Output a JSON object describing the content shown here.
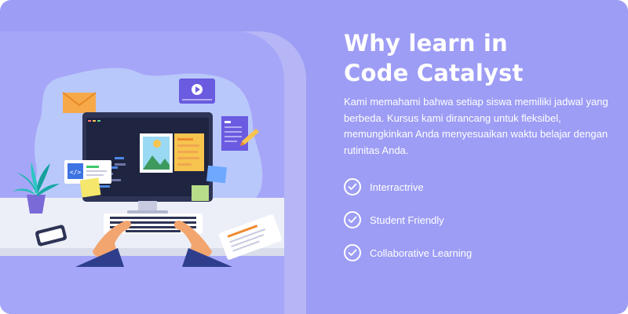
{
  "section": {
    "title_line1": "Why learn in",
    "title_line2": "Code Catalyst",
    "description": "Kami memahami bahwa setiap siswa memiliki jadwal yang berbeda. Kursus kami dirancang untuk fleksibel, memungkinkan Anda menyesuaikan waktu belajar dengan rutinitas Anda.",
    "features": [
      {
        "label": "Interractrive",
        "icon": "check-circle-icon"
      },
      {
        "label": "Student Friendly",
        "icon": "check-circle-icon"
      },
      {
        "label": "Collaborative Learning",
        "icon": "check-circle-icon"
      }
    ]
  },
  "colors": {
    "background": "#9d9df5",
    "panel": "#a6a6f8",
    "panel_back": "#b6b6f7",
    "text": "#ffffff"
  },
  "illustration": {
    "icons": [
      "envelope-icon",
      "video-play-icon",
      "code-icon",
      "document-icon",
      "pencil-icon",
      "plant-icon",
      "phone-icon",
      "notebook-icon",
      "keyboard-icon",
      "monitor-icon",
      "image-icon"
    ]
  }
}
